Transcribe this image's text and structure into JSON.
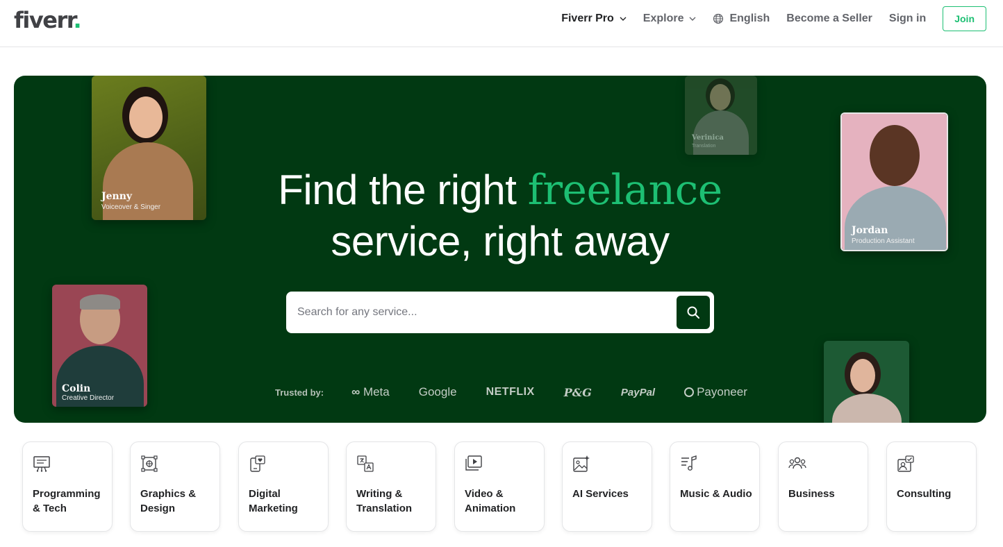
{
  "header": {
    "logo_text": "fiverr",
    "logo_dot": ".",
    "nav": {
      "fiverr_pro": "Fiverr Pro",
      "explore": "Explore",
      "language": "English",
      "become_seller": "Become a Seller",
      "sign_in": "Sign in",
      "join": "Join"
    }
  },
  "hero": {
    "title_part1": "Find the right ",
    "title_accent": "freelance",
    "title_line2": "service, right away",
    "search": {
      "placeholder": "Search for any service..."
    },
    "trusted": {
      "label": "Trusted by:",
      "brands": [
        "Meta",
        "Google",
        "NETFLIX",
        "P&G",
        "PayPal",
        "Payoneer"
      ]
    },
    "people": [
      {
        "name": "Jenny",
        "role": "Voiceover & Singer"
      },
      {
        "name": "Verinica",
        "role": "Translation"
      },
      {
        "name": "Jordan",
        "role": "Production Assistant"
      },
      {
        "name": "Colin",
        "role": "Creative Director"
      }
    ]
  },
  "categories": [
    {
      "label": "Programming & Tech",
      "icon": "monitor-code-icon"
    },
    {
      "label": "Graphics & Design",
      "icon": "vector-design-icon"
    },
    {
      "label": "Digital Marketing",
      "icon": "phone-heart-icon"
    },
    {
      "label": "Writing & Translation",
      "icon": "translate-icon"
    },
    {
      "label": "Video & Animation",
      "icon": "video-play-icon"
    },
    {
      "label": "AI Services",
      "icon": "ai-image-icon"
    },
    {
      "label": "Music & Audio",
      "icon": "music-note-icon"
    },
    {
      "label": "Business",
      "icon": "people-group-icon"
    },
    {
      "label": "Consulting",
      "icon": "consulting-icon"
    }
  ],
  "colors": {
    "brand_green": "#1dbf73",
    "hero_bg": "#013912",
    "text_dark": "#222325"
  }
}
